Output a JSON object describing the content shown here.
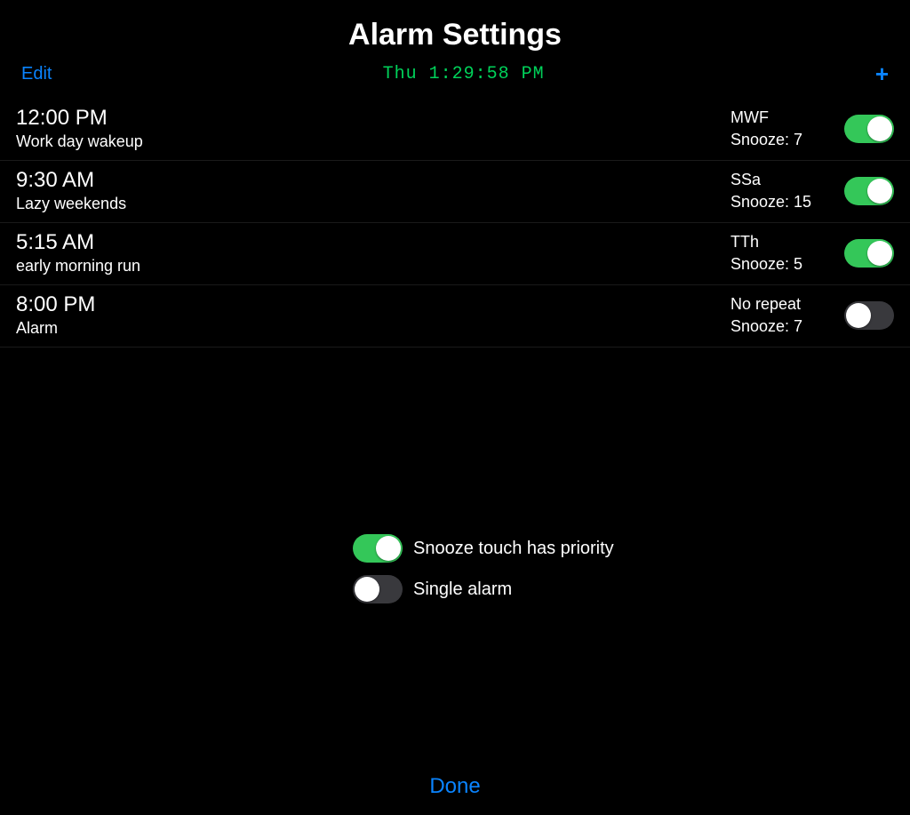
{
  "title": "Alarm Settings",
  "toolbar": {
    "edit_label": "Edit",
    "clock": "Thu 1:29:58 PM",
    "add_symbol": "+"
  },
  "snooze_prefix": "Snooze: ",
  "alarms": [
    {
      "time": "12:00 PM",
      "label": "Work day wakeup",
      "repeat": "MWF",
      "snooze": "7",
      "on": true
    },
    {
      "time": "9:30 AM",
      "label": "Lazy weekends",
      "repeat": "SSa",
      "snooze": "15",
      "on": true
    },
    {
      "time": "5:15 AM",
      "label": "early morning run",
      "repeat": "TTh",
      "snooze": "5",
      "on": true
    },
    {
      "time": "8:00 PM",
      "label": "Alarm",
      "repeat": "No repeat",
      "snooze": "7",
      "on": false
    }
  ],
  "options": {
    "snooze_priority": {
      "label": "Snooze touch has priority",
      "on": true
    },
    "single_alarm": {
      "label": "Single alarm",
      "on": false
    }
  },
  "done_label": "Done"
}
